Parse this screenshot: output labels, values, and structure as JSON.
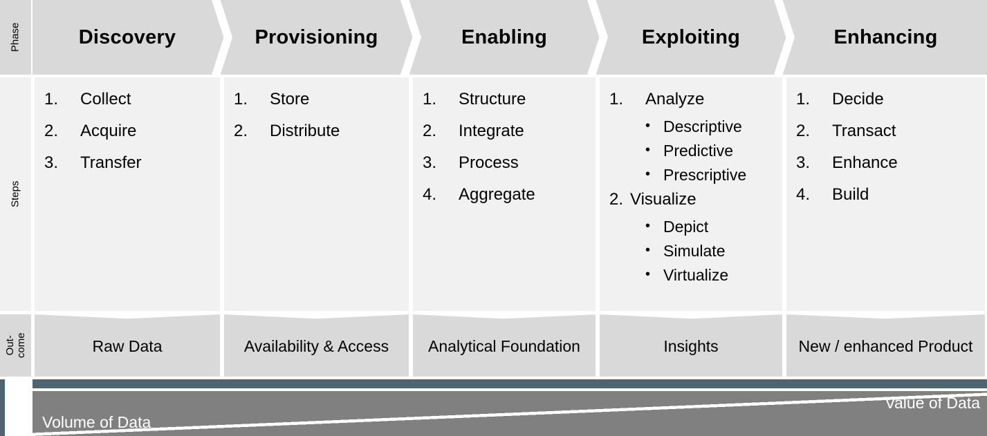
{
  "row_labels": {
    "phase": "Phase",
    "steps": "Steps",
    "outcome": "Out-\ncome",
    "outcome_line1": "Out-",
    "outcome_line2": "come"
  },
  "colors": {
    "header_fill": "#d9d9d9",
    "steps_fill": "#f1f1f1",
    "outcome_fill": "#d9d9d9",
    "teal_bar": "#4c6570",
    "band_gray": "#808080",
    "text": "#000000",
    "band_text": "#ffffff"
  },
  "columns": [
    {
      "phase": "Discovery",
      "steps": [
        {
          "num": "1.",
          "label": "Collect",
          "sub": []
        },
        {
          "num": "2.",
          "label": "Acquire",
          "sub": []
        },
        {
          "num": "3.",
          "label": "Transfer",
          "sub": []
        }
      ],
      "outcome": "Raw Data"
    },
    {
      "phase": "Provisioning",
      "steps": [
        {
          "num": "1.",
          "label": "Store",
          "sub": []
        },
        {
          "num": "2.",
          "label": "Distribute",
          "sub": []
        }
      ],
      "outcome": "Availability & Access"
    },
    {
      "phase": "Enabling",
      "steps": [
        {
          "num": "1.",
          "label": "Structure",
          "sub": []
        },
        {
          "num": "2.",
          "label": "Integrate",
          "sub": []
        },
        {
          "num": "3.",
          "label": "Process",
          "sub": []
        },
        {
          "num": "4.",
          "label": "Aggregate",
          "sub": []
        }
      ],
      "outcome": "Analytical Foundation"
    },
    {
      "phase": "Exploiting",
      "steps": [
        {
          "num": "1.",
          "label": "Analyze",
          "sub": [
            "Descriptive",
            "Predictive",
            "Prescriptive"
          ]
        },
        {
          "num": "2.",
          "label": "Visualize",
          "sub": [
            "Depict",
            "Simulate",
            "Virtualize"
          ]
        }
      ],
      "outcome": "Insights"
    },
    {
      "phase": "Enhancing",
      "steps": [
        {
          "num": "1.",
          "label": "Decide",
          "sub": []
        },
        {
          "num": "2.",
          "label": "Transact",
          "sub": []
        },
        {
          "num": "3.",
          "label": "Enhance",
          "sub": []
        },
        {
          "num": "4.",
          "label": "Build",
          "sub": []
        }
      ],
      "outcome": "New / enhanced Product"
    }
  ],
  "band": {
    "left_label": "Volume of Data",
    "right_label": "Value of Data"
  },
  "bullet_glyph": "•"
}
